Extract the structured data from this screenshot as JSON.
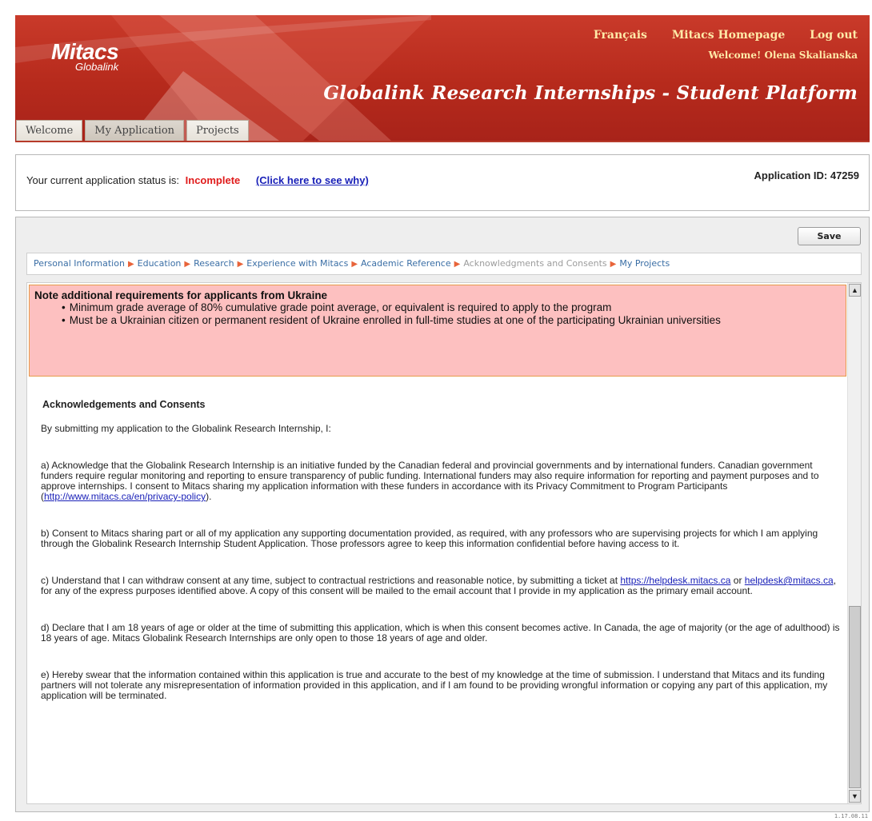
{
  "header": {
    "logo_word": "Mitacs",
    "logo_sub": "Globalink",
    "links": {
      "french": "Français",
      "homepage": "Mitacs Homepage",
      "logout": "Log out"
    },
    "welcome": "Welcome! Olena Skalianska",
    "platform_title": "Globalink Research Internships - Student Platform",
    "tabs": [
      {
        "label": "Welcome"
      },
      {
        "label": "My Application",
        "active": true
      },
      {
        "label": "Projects"
      }
    ],
    "brand_color": "#b62a1c"
  },
  "status": {
    "label": "Your current application status is:",
    "value": "Incomplete",
    "value_color": "#e01b1b",
    "why_link": "(Click here to see why)",
    "app_id": "Application ID: 47259"
  },
  "toolbar": {
    "save_label": "Save"
  },
  "breadcrumb": [
    {
      "label": "Personal Information"
    },
    {
      "label": "Education"
    },
    {
      "label": "Research"
    },
    {
      "label": "Experience with Mitacs"
    },
    {
      "label": "Academic Reference"
    },
    {
      "label": "Acknowledgments and Consents",
      "current": true
    },
    {
      "label": "My Projects"
    }
  ],
  "notice": {
    "title": "Note additional requirements for applicants from Ukraine",
    "items": [
      "Minimum grade average of 80% cumulative grade point average, or equivalent is required to apply to the program",
      "Must be a Ukrainian citizen or permanent resident of Ukraine enrolled in full-time studies at one of the participating Ukrainian universities"
    ]
  },
  "consent": {
    "heading": "Acknowledgements and Consents",
    "intro": "By submitting my application to the Globalink Research Internship, I:",
    "a_text": "a) Acknowledge that the Globalink Research Internship is an initiative funded by the Canadian federal and provincial governments and by international funders. Canadian government funders require regular monitoring and reporting to ensure transparency of public funding. International funders may also require information for reporting and payment purposes and to approve internships. I consent to Mitacs sharing my application information with these funders in accordance with its Privacy Commitment to Program Participants (",
    "a_link": "http://www.mitacs.ca/en/privacy-policy",
    "a_end": ").",
    "b_text": "b) Consent to Mitacs sharing part or all of my application any supporting documentation provided, as required, with any professors who are supervising projects for which I am applying through the Globalink Research Internship Student Application. Those professors agree to keep this information confidential before having access to it.",
    "c_text1": "c) Understand that I can withdraw consent at any time, subject to contractual restrictions and reasonable notice, by submitting a ticket at ",
    "c_link1": "https://helpdesk.mitacs.ca",
    "c_text2": " or ",
    "c_link2": "helpdesk@mitacs.ca",
    "c_text3": ", for any of the express purposes identified above. A copy of this consent will be mailed to the email account that I provide in my application as the primary email account.",
    "d_text": "d) Declare that I am 18 years of age or older at the time of submitting this application, which is when this consent becomes active. In Canada, the age of majority (or the age of adulthood) is 18 years of age. Mitacs Globalink Research Internships are only open to those 18 years of age and older.",
    "e_text": "e) Hereby swear that the information contained within this application is true and accurate to the best of my knowledge at the time of submission. I understand that Mitacs and its funding partners will not tolerate any misrepresentation of information provided in this application, and if I am found to be providing wrongful information or copying any part of this application, my application will be terminated."
  },
  "version": "1.17.08.11"
}
